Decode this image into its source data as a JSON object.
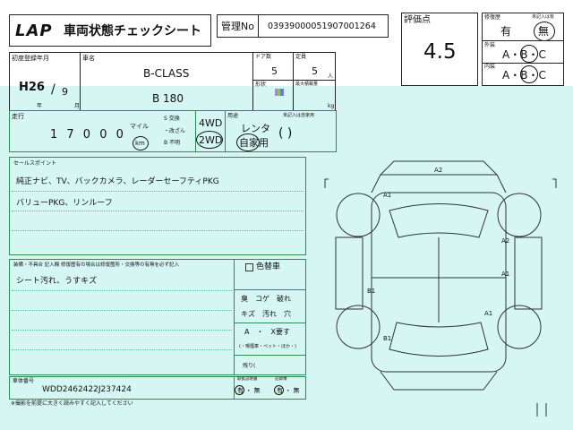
{
  "header": {
    "logo": "LAP",
    "title": "車両状態チェックシート",
    "mgmt_label": "管理No",
    "mgmt_no": "03939000051907001264",
    "grade_label": "評価点",
    "grade": "4.5"
  },
  "repair": {
    "repair_label": "修復歴",
    "repair_note": "未記入は有",
    "repair_has": "有",
    "repair_none": "無",
    "exterior_label": "外装",
    "interior_label": "内装",
    "abc": "A・B・C"
  },
  "vehicle": {
    "first_reg_label": "初度登録年月",
    "first_reg_era": "H26",
    "first_reg_month": "9",
    "year_unit": "年",
    "month_unit": "月",
    "car_name_label": "車名",
    "car_name": "B-CLASS",
    "car_grade": "B 180",
    "doors_label": "ドア数",
    "doors": "5",
    "capacity_label": "定員",
    "capacity": "5",
    "capacity_unit": "人",
    "shape_label": "形状",
    "loading_label": "最大積載量",
    "loading_unit": "kg"
  },
  "mileage": {
    "label": "走行",
    "value": "1 7 0 0 0",
    "mile": "マイル",
    "km": "km",
    "meter_opts": [
      "S 交換",
      "・改ざん",
      "B 不明"
    ],
    "drive_4wd": "4WD",
    "drive_2wd": "2WD",
    "use_label": "用途",
    "use_note": "未記入は自家用",
    "use_rental": "レンタ",
    "use_private": "自家用",
    "use_paren": "(                   )"
  },
  "sales_points": {
    "label": "セールスポイント",
    "line1": "純正ナビ、TV、バックカメラ、レーダーセーフティPKG",
    "line2": "バリューPKG、リンルーフ"
  },
  "remarks": {
    "label": "装備・不具合 記入欄 修復歴有の場合は修復箇所・交換等の有無を必ず記入",
    "line1": "シート汚れ、うすキズ",
    "color_change": "色替車",
    "smell_row1": "臭　コゲ　破れ",
    "smell_row2": "キズ　汚れ　穴",
    "smoke": "A　・　X要す",
    "smoke_note": "(・喫煙車・ペット・ほか・)",
    "other_label": "残り("
  },
  "chassis": {
    "label": "車体番号",
    "value": "WDD2462422J237424",
    "manual_label": "取扱説明書",
    "manual_opts": "有 ・ 無",
    "record_label": "記録簿",
    "record_opts": "有 ・ 無"
  },
  "footer_note": "※撮影を前提に大きく読みやすく記入してください",
  "diagram": {
    "marks": [
      {
        "label": "A2",
        "pos": "roof"
      },
      {
        "label": "A1",
        "pos": "front-left fender"
      },
      {
        "label": "A2",
        "pos": "front-right door"
      },
      {
        "label": "A1",
        "pos": "right door"
      },
      {
        "label": "B1",
        "pos": "left door"
      },
      {
        "label": "A1",
        "pos": "rear-right fender"
      },
      {
        "label": "B1",
        "pos": "rear-left fender"
      }
    ]
  }
}
